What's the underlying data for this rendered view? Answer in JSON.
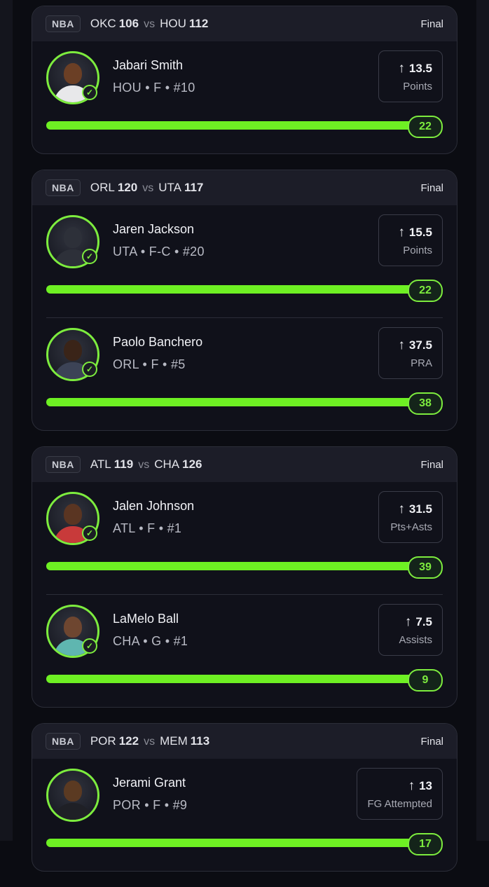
{
  "colors": {
    "background": "#0b0c12",
    "card": "#10111a",
    "card_header": "#1c1d28",
    "accent_green": "#7dec3e",
    "progress_green": "#6ef023"
  },
  "games": [
    {
      "league": "NBA",
      "away_team": "OKC",
      "away_score": "106",
      "vs": "vs",
      "home_team": "HOU",
      "home_score": "112",
      "status": "Final",
      "picks": [
        {
          "player_name": "Jabari Smith",
          "meta": "HOU • F • #10",
          "line": "13.5",
          "stat_type": "Points",
          "result": "22",
          "progress": 1.0,
          "direction_icon": "arrow-up-icon",
          "status_icon": "check-icon"
        }
      ]
    },
    {
      "league": "NBA",
      "away_team": "ORL",
      "away_score": "120",
      "vs": "vs",
      "home_team": "UTA",
      "home_score": "117",
      "status": "Final",
      "picks": [
        {
          "player_name": "Jaren Jackson",
          "meta": "UTA • F-C • #20",
          "line": "15.5",
          "stat_type": "Points",
          "result": "22",
          "progress": 1.0,
          "direction_icon": "arrow-up-icon",
          "status_icon": "check-icon"
        },
        {
          "player_name": "Paolo Banchero",
          "meta": "ORL • F • #5",
          "line": "37.5",
          "stat_type": "PRA",
          "result": "38",
          "progress": 1.0,
          "direction_icon": "arrow-up-icon",
          "status_icon": "check-icon"
        }
      ]
    },
    {
      "league": "NBA",
      "away_team": "ATL",
      "away_score": "119",
      "vs": "vs",
      "home_team": "CHA",
      "home_score": "126",
      "status": "Final",
      "picks": [
        {
          "player_name": "Jalen Johnson",
          "meta": "ATL • F • #1",
          "line": "31.5",
          "stat_type": "Pts+Asts",
          "result": "39",
          "progress": 1.0,
          "direction_icon": "arrow-up-icon",
          "status_icon": "check-icon"
        },
        {
          "player_name": "LaMelo Ball",
          "meta": "CHA • G • #1",
          "line": "7.5",
          "stat_type": "Assists",
          "result": "9",
          "progress": 1.0,
          "direction_icon": "arrow-up-icon",
          "status_icon": "check-icon"
        }
      ]
    },
    {
      "league": "NBA",
      "away_team": "POR",
      "away_score": "122",
      "vs": "vs",
      "home_team": "MEM",
      "home_score": "113",
      "status": "Final",
      "picks": [
        {
          "player_name": "Jerami Grant",
          "meta": "POR • F • #9",
          "line": "13",
          "stat_type": "FG Attempted",
          "result": "17",
          "progress": 1.0,
          "direction_icon": "arrow-up-icon",
          "status_icon": "check-icon"
        }
      ]
    }
  ]
}
